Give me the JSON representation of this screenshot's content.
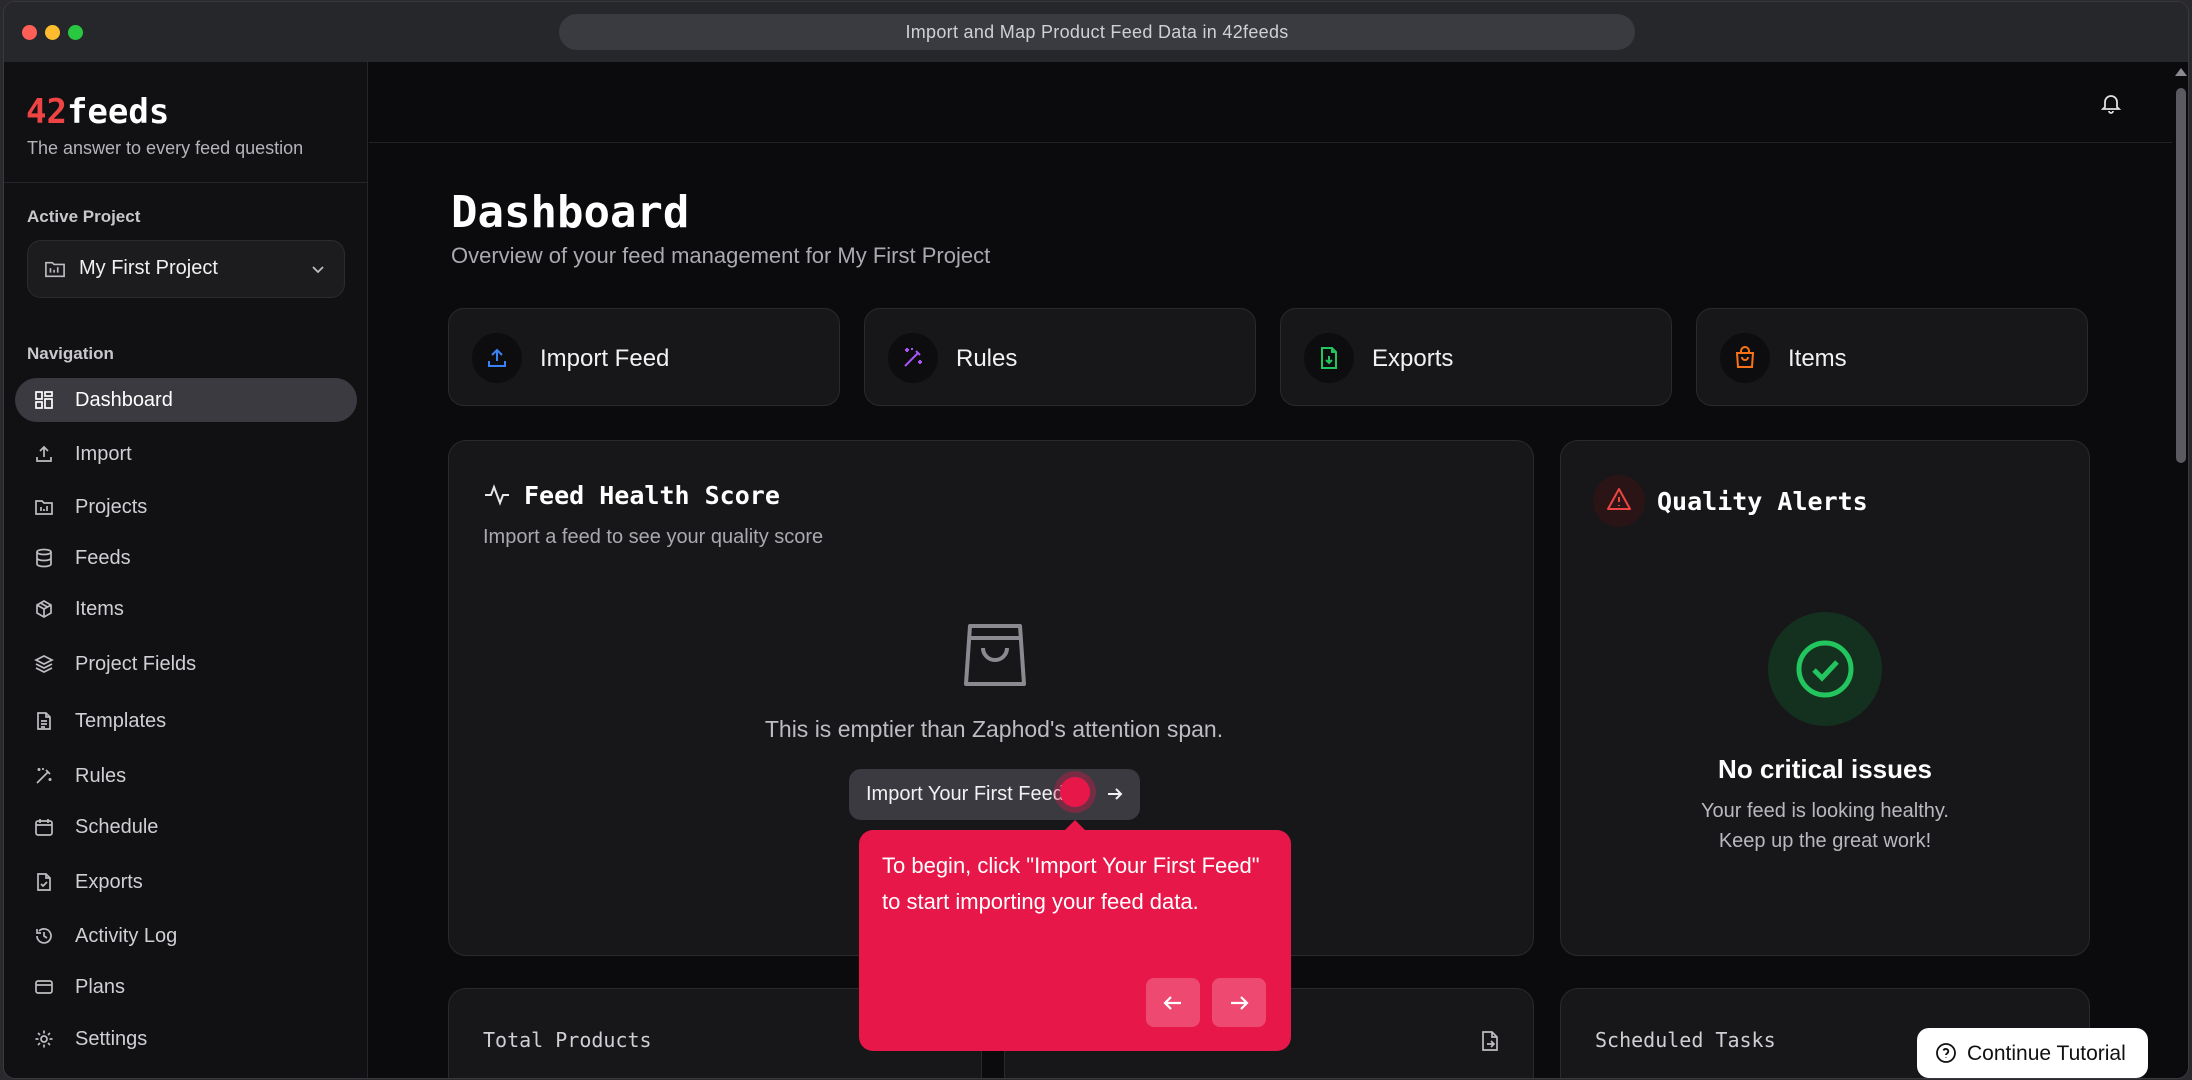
{
  "window": {
    "url_title": "Import and Map Product Feed Data in 42feeds"
  },
  "brand": {
    "prefix": "42",
    "suffix": "feeds",
    "tagline": "The answer to every feed question"
  },
  "sidebar": {
    "active_project_label": "Active Project",
    "project_name": "My First Project",
    "navigation_label": "Navigation",
    "items": [
      {
        "label": "Dashboard",
        "icon": "dashboard-grid-icon",
        "active": true
      },
      {
        "label": "Import",
        "icon": "upload-icon"
      },
      {
        "label": "Projects",
        "icon": "folder-icon"
      },
      {
        "label": "Feeds",
        "icon": "database-icon"
      },
      {
        "label": "Items",
        "icon": "box-icon"
      },
      {
        "label": "Project Fields",
        "icon": "layers-icon"
      },
      {
        "label": "Templates",
        "icon": "file-text-icon"
      },
      {
        "label": "Rules",
        "icon": "magic-wand-icon"
      },
      {
        "label": "Schedule",
        "icon": "calendar-icon"
      },
      {
        "label": "Exports",
        "icon": "file-check-icon"
      },
      {
        "label": "Activity Log",
        "icon": "history-icon"
      },
      {
        "label": "Plans",
        "icon": "credit-card-icon"
      },
      {
        "label": "Settings",
        "icon": "gear-icon"
      }
    ]
  },
  "main": {
    "title": "Dashboard",
    "subtitle": "Overview of your feed management for My First Project",
    "quick_actions": [
      {
        "label": "Import Feed",
        "icon": "upload-icon",
        "color": "#3b82f6"
      },
      {
        "label": "Rules",
        "icon": "magic-wand-icon",
        "color": "#a855f7"
      },
      {
        "label": "Exports",
        "icon": "file-download-icon",
        "color": "#22c55e"
      },
      {
        "label": "Items",
        "icon": "shopping-bag-icon",
        "color": "#f97316"
      }
    ],
    "health": {
      "title": "Feed Health Score",
      "subtitle": "Import a feed to see your quality score",
      "empty_text": "This is emptier than Zaphod's attention span.",
      "button": "Import Your First Feed"
    },
    "alerts": {
      "title": "Quality Alerts",
      "ok_title": "No critical issues",
      "ok_line1": "Your feed is looking healthy.",
      "ok_line2": "Keep up the great work!"
    },
    "stats": [
      {
        "title": "Total Products"
      },
      {
        "title": ""
      },
      {
        "title": "Scheduled Tasks"
      }
    ]
  },
  "tutorial": {
    "text": "To begin, click \"Import Your First Feed\" to start importing your feed data.",
    "continue": "Continue Tutorial"
  },
  "colors": {
    "accent": "#e8174a",
    "brand_red": "#ef4444",
    "success": "#22c55e"
  }
}
